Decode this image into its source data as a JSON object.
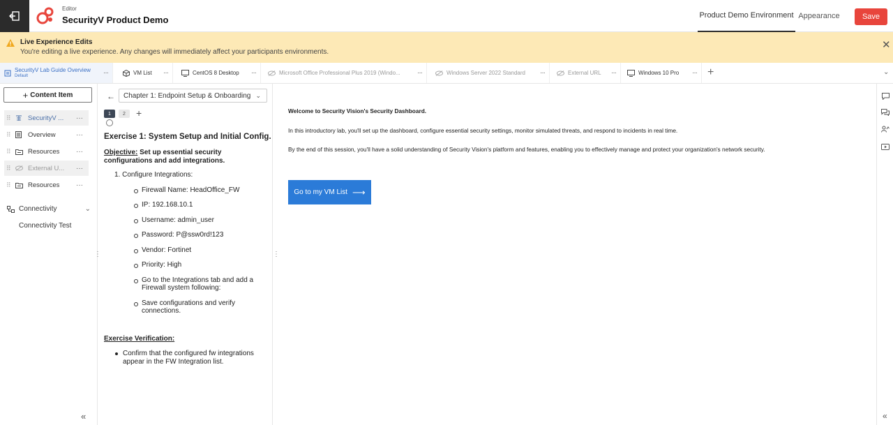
{
  "header": {
    "subtitle": "Editor",
    "title": "SecurityV Product Demo",
    "tabs": [
      {
        "label": "Product Demo Environment",
        "active": true
      },
      {
        "label": "Appearance",
        "active": false
      }
    ],
    "save_label": "Save",
    "brand_color": "#e8453c"
  },
  "banner": {
    "title": "Live Experience Edits",
    "text": "You're editing a live experience. Any changes will immediately affect your participants environments.",
    "background": "#fde9b6"
  },
  "tabs": [
    {
      "label": "SecurityV Lab Guide Overview",
      "sublabel": "Default",
      "icon": "guide-icon",
      "active": true
    },
    {
      "label": "VM List",
      "icon": "cube-icon"
    },
    {
      "label": "CentOS 8 Desktop",
      "icon": "monitor-icon"
    },
    {
      "label": "Microsoft Office Professional Plus 2019 (Windo...",
      "icon": "eye-off-icon",
      "dim": true
    },
    {
      "label": "Windows Server 2022 Standard",
      "icon": "eye-off-icon",
      "dim": true
    },
    {
      "label": "External URL",
      "icon": "eye-off-icon",
      "dim": true
    },
    {
      "label": "Windows 10 Pro",
      "icon": "monitor-icon"
    }
  ],
  "left": {
    "content_button": "Content Item",
    "items": [
      {
        "label": "SecurityV ...",
        "icon": "guide-icon",
        "selected": true
      },
      {
        "label": "Overview",
        "icon": "document-icon"
      },
      {
        "label": "Resources",
        "icon": "folder-icon"
      },
      {
        "label": "External U...",
        "icon": "eye-off-icon",
        "selected": true,
        "dim": true
      },
      {
        "label": "Resources",
        "icon": "folder-icon"
      }
    ],
    "connectivity": "Connectivity",
    "connectivity_test": "Connectivity Test"
  },
  "guide": {
    "chapter": "Chapter 1: Endpoint Setup & Onboarding",
    "pages": [
      "1",
      "2"
    ],
    "exercise_title": "Exercise 1: System Setup and Initial Config...",
    "objective_label": "Objective:",
    "objective_text": "Set up essential security configurations and add integrations.",
    "step": "1. Configure Integrations:",
    "bullets": [
      "Firewall Name: HeadOffice_FW",
      "IP: 192.168.10.1",
      "Username: admin_user",
      "Password: P@ssw0rd!123",
      "Vendor: Fortinet",
      "Priority: High",
      "Go to the Integrations tab and add a Firewall system following:",
      "Save configurations and verify connections."
    ],
    "verification_title": "Exercise Verification:",
    "verification_text": "Confirm that the configured fw integrations appear in the FW Integration list."
  },
  "main": {
    "heading": "Welcome to Security Vision's Security Dashboard.",
    "para1": "In this introductory lab, you'll set up the dashboard, configure essential security settings, monitor simulated threats, and respond to incidents in real time.",
    "para2": "By the end of this session, you'll have a solid understanding of Security Vision's platform and features, enabling you to effectively manage and protect your organization's network security.",
    "button": "Go to my VM List",
    "button_color": "#2b7bd8"
  }
}
